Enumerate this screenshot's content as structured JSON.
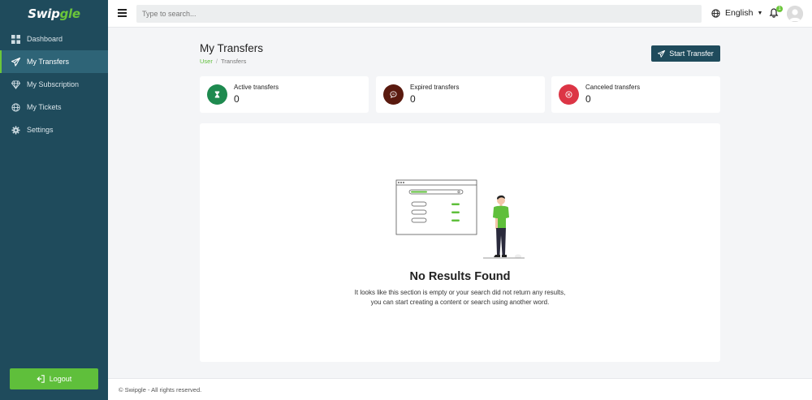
{
  "app": {
    "logo_text": "Swipgle"
  },
  "sidebar": {
    "items": [
      {
        "label": "Dashboard",
        "icon": "grid-icon",
        "active": false
      },
      {
        "label": "My Transfers",
        "icon": "paper-plane-icon",
        "active": true
      },
      {
        "label": "My Subscription",
        "icon": "diamond-icon",
        "active": false
      },
      {
        "label": "My Tickets",
        "icon": "globe-icon",
        "active": false
      },
      {
        "label": "Settings",
        "icon": "gear-icon",
        "active": false
      }
    ],
    "logout_label": "Logout"
  },
  "topbar": {
    "search_placeholder": "Type to search...",
    "language": "English",
    "notification_count": "1"
  },
  "page": {
    "title": "My Transfers",
    "breadcrumb": {
      "link": "User",
      "separator": "/",
      "current": "Transfers"
    },
    "start_button": "Start Transfer"
  },
  "stats": [
    {
      "label": "Active transfers",
      "value": "0",
      "color": "#1e8a4f",
      "icon": "hourglass-icon"
    },
    {
      "label": "Expired transfers",
      "value": "0",
      "color": "#5a1a0f",
      "icon": "chat-icon"
    },
    {
      "label": "Canceled transfers",
      "value": "0",
      "color": "#dc3545",
      "icon": "close-circle-icon"
    }
  ],
  "empty": {
    "title": "No Results Found",
    "line1": "It looks like this section is empty or your search did not return any results,",
    "line2": "you can start creating a content or search using another word."
  },
  "footer": {
    "text": "© Swipgle - All rights reserved."
  },
  "colors": {
    "sidebar": "#1f4b5c",
    "accent": "#5fbf3b",
    "primary_button": "#1f4b5c"
  }
}
